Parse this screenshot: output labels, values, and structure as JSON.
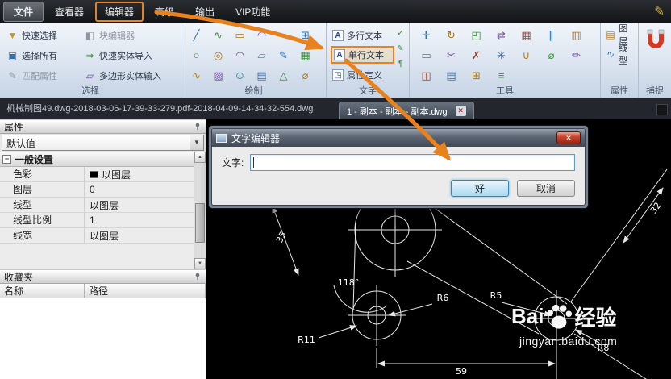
{
  "menubar": {
    "items": [
      "文件",
      "查看器",
      "编辑器",
      "高级",
      "输出",
      "VIP功能"
    ]
  },
  "ribbon": {
    "selection": {
      "label": "选择",
      "items": [
        "快速选择",
        "块编辑器",
        "选择所有",
        "快速实体导入",
        "匹配属性",
        "多边形实体输入"
      ]
    },
    "draw": {
      "label": "绘制"
    },
    "text": {
      "label": "文字",
      "items": [
        "多行文本",
        "单行文本",
        "属性定义"
      ]
    },
    "tools": {
      "label": "工具"
    },
    "props": {
      "label": "属性",
      "items": [
        "图层",
        "线型"
      ]
    },
    "snap": {
      "label": "捕捉"
    }
  },
  "tabbar": {
    "path_text": "机械制图49.dwg-2018-03-06-17-39-33-279.pdf-2018-04-09-14-34-32-554.dwg",
    "active_tab": "1 - 副本 - 副本 - 副本.dwg"
  },
  "properties_panel": {
    "title": "属性",
    "preset_value": "默认值",
    "group_title": "一般设置",
    "rows": [
      {
        "label": "色彩",
        "value": "以图层"
      },
      {
        "label": "图层",
        "value": "0"
      },
      {
        "label": "线型",
        "value": "以图层"
      },
      {
        "label": "线型比例",
        "value": "1"
      },
      {
        "label": "线宽",
        "value": "以图层"
      }
    ]
  },
  "favorites_panel": {
    "title": "收藏夹",
    "columns": [
      "名称",
      "路径"
    ]
  },
  "dialog": {
    "title": "文字编辑器",
    "field_label": "文字:",
    "input_value": "",
    "ok": "好",
    "cancel": "取消"
  },
  "drawing": {
    "labels": {
      "dim35": "35",
      "angle118": "118°",
      "r6": "R6",
      "r5": "R5",
      "r11": "R11",
      "r8": "R8",
      "dim59": "59",
      "dim32": "32"
    }
  },
  "watermark": {
    "prefix": "Bai",
    "suffix": "经验",
    "domain": "jingyan.baidu.com"
  },
  "colors": {
    "accent_orange": "#e8821e",
    "snap_red": "#d43a22"
  },
  "icons": {
    "pencil": "✎",
    "quick_select": "▼",
    "block_editor": "◧",
    "select_all": "▣",
    "entity_import": "⇒",
    "match_props": "✎",
    "polygon_input": "▱",
    "draw": [
      "╱",
      "∿",
      "▭",
      "◠",
      "≈",
      "⊞",
      "○",
      "◎",
      "◠",
      "▱",
      "✎",
      "▦",
      "∿",
      "▨",
      "⊙",
      "▤",
      "△",
      "⌀"
    ],
    "text_letter": "A",
    "attr_def": "◳",
    "spell_check": "✓",
    "side_edit": "✎",
    "side_para": "¶",
    "tools": [
      "✛",
      "↻",
      "◰",
      "⇄",
      "▦",
      "∥",
      "▥",
      "▭",
      "✂",
      "✗",
      "✳",
      "∪",
      "⌀",
      "✏",
      "◫",
      "▤",
      "⊞",
      "≡"
    ],
    "layers": "▤",
    "linetype": "∿",
    "caret_down": "▾",
    "arrow_up": "▲",
    "arrow_down": "▼",
    "close": "✕",
    "minus": "−"
  }
}
